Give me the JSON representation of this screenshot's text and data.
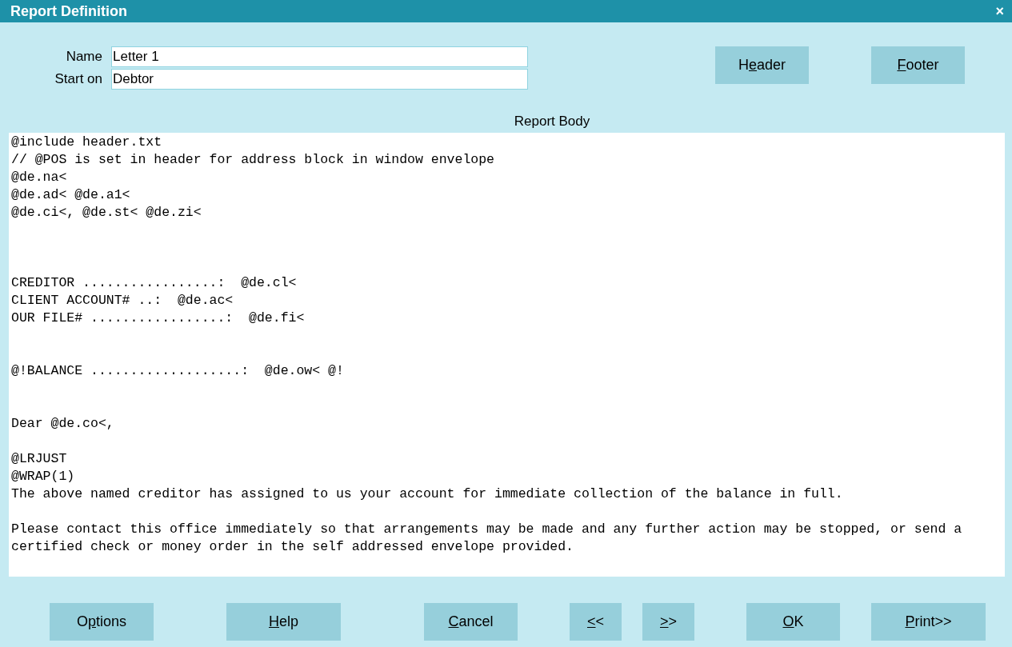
{
  "window": {
    "title": "Report Definition",
    "close": "×"
  },
  "fields": [
    {
      "label": "Name",
      "value": "Letter 1"
    },
    {
      "label": "Start on",
      "value": "Debtor"
    }
  ],
  "top_buttons": [
    {
      "before": "H",
      "underlined": "e",
      "after": "ader"
    },
    {
      "underlined": "F",
      "after": "ooter"
    }
  ],
  "body": {
    "title": "Report Body",
    "text": "@include header.txt\n// @POS is set in header for address block in window envelope\n@de.na<\n@de.ad< @de.a1<\n@de.ci<, @de.st< @de.zi<\n\n\n\nCREDITOR .................:  @de.cl<\nCLIENT ACCOUNT# ..:  @de.ac<\nOUR FILE# .................:  @de.fi<\n\n\n@!BALANCE ...................:  @de.ow< @!\n\n\nDear @de.co<,\n\n@LRJUST\n@WRAP(1)\nThe above named creditor has assigned to us your account for immediate collection of the balance in full.\n\nPlease contact this office immediately so that arrangements may be made and any further action may be stopped, or send a\ncertified check or money order in the self addressed envelope provided."
  },
  "bottom_buttons": [
    {
      "before": "O",
      "underlined": "p",
      "after": "tions"
    },
    {
      "underlined": "H",
      "after": "elp"
    },
    {
      "underlined": "C",
      "after": "ancel"
    },
    {
      "underlined": "<",
      "after": "<"
    },
    {
      "underlined": ">",
      "after": ">"
    },
    {
      "underlined": "O",
      "after": "K"
    },
    {
      "underlined": "P",
      "after": "rint>>"
    }
  ]
}
